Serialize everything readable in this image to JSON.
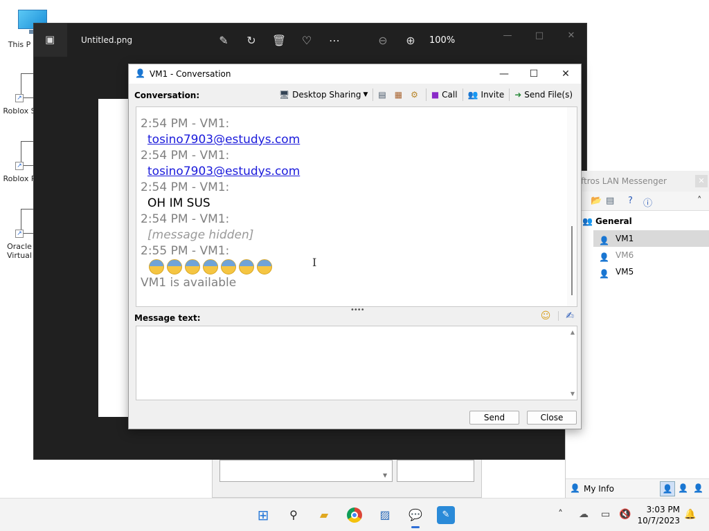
{
  "desktop": {
    "icons": [
      {
        "label": "This P",
        "icon": "computer-icon"
      },
      {
        "label": "Roblox S",
        "icon": "shortcut-icon"
      },
      {
        "label": "Roblox P",
        "icon": "shortcut-icon"
      },
      {
        "label": "Oracle",
        "label2": "Virtual",
        "icon": "shortcut-icon"
      }
    ]
  },
  "photos": {
    "file_title": "Untitled.png",
    "zoom": "100%",
    "icons": [
      "edit-icon",
      "rotate-icon",
      "delete-icon",
      "favorite-icon",
      "more-icon",
      "zoom-out-icon",
      "zoom-in-icon"
    ]
  },
  "conversation": {
    "window_title": "VM1 - Conversation",
    "header_label": "Conversation:",
    "toolbar": {
      "desktop_sharing": "Desktop Sharing",
      "call": "Call",
      "invite": "Invite",
      "send_files": "Send File(s)"
    },
    "messages": [
      {
        "header": "2:54 PM - VM1:",
        "body": "tosino7903@estudys.com",
        "link": true
      },
      {
        "header": "2:54 PM - VM1:",
        "body": "tosino7903@estudys.com",
        "link": true
      },
      {
        "header": "2:54 PM - VM1:",
        "body": "OH IM SUS",
        "link": false
      },
      {
        "header": "2:54 PM - VM1:",
        "body": "[message hidden]",
        "link": false
      }
    ],
    "emoji_message": {
      "header": "2:55 PM - VM1:",
      "emoji_count": 7,
      "emoji_name": "anxious-face-with-sweat"
    },
    "status_line": "VM1 is available",
    "message_label": "Message text:",
    "send_label": "Send",
    "close_label": "Close"
  },
  "lan_messenger": {
    "title": "ftros LAN Messenger",
    "group": "General",
    "users": [
      {
        "name": "VM1",
        "selected": true,
        "status": "online"
      },
      {
        "name": "VM6",
        "selected": false,
        "status": "online"
      },
      {
        "name": "VM5",
        "selected": false,
        "status": "busy"
      }
    ],
    "my_info_label": "My Info"
  },
  "taskbar": {
    "apps": [
      "start-icon",
      "search-icon",
      "file-explorer-icon",
      "chrome-icon",
      "photos-icon",
      "lan-messenger-icon",
      "paint-icon"
    ],
    "time": "3:03 PM",
    "date": "10/7/2023"
  },
  "colors": {
    "link": "#1a1adb",
    "timestamp": "#808080",
    "photos_bg": "#202020",
    "accent": "#2f6fd6"
  }
}
